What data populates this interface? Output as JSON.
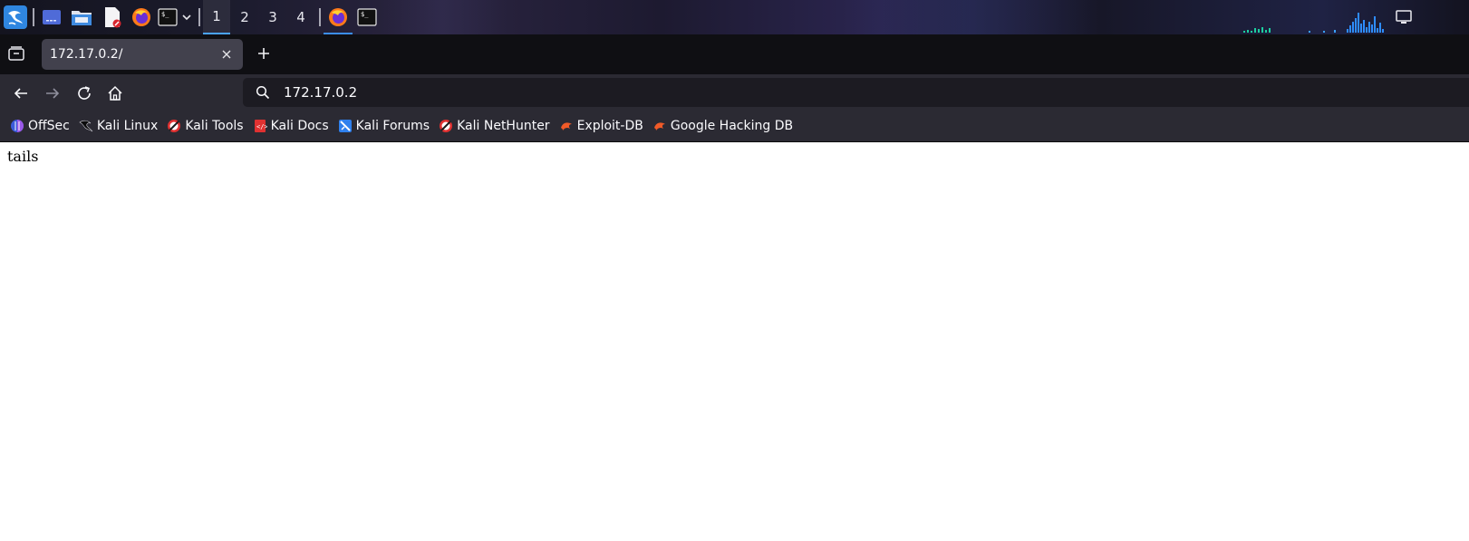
{
  "taskbar": {
    "workspaces": [
      "1",
      "2",
      "3",
      "4"
    ],
    "active_workspace": "1",
    "launchers": [
      "kali-menu-icon",
      "desktop-icon",
      "file-manager-icon",
      "text-editor-icon",
      "firefox-icon",
      "terminal-icon"
    ],
    "running_apps": [
      "firefox-icon",
      "terminal-icon"
    ]
  },
  "browser": {
    "tab": {
      "title": "172.17.0.2/"
    },
    "url": "172.17.0.2",
    "bookmarks": [
      {
        "label": "OffSec",
        "icon": "offsec-icon"
      },
      {
        "label": "Kali Linux",
        "icon": "kali-dragon-icon"
      },
      {
        "label": "Kali Tools",
        "icon": "kali-tools-icon"
      },
      {
        "label": "Kali Docs",
        "icon": "kali-docs-icon"
      },
      {
        "label": "Kali Forums",
        "icon": "kali-forums-icon"
      },
      {
        "label": "Kali NetHunter",
        "icon": "kali-nethunter-icon"
      },
      {
        "label": "Exploit-DB",
        "icon": "exploit-db-icon"
      },
      {
        "label": "Google Hacking DB",
        "icon": "ghdb-icon"
      }
    ]
  },
  "page": {
    "body_text": "tails"
  },
  "colors": {
    "accent": "#3b8df0",
    "toolbar": "#2b2a33",
    "tab_active": "#42414d",
    "urlbar": "#1c1b22"
  }
}
